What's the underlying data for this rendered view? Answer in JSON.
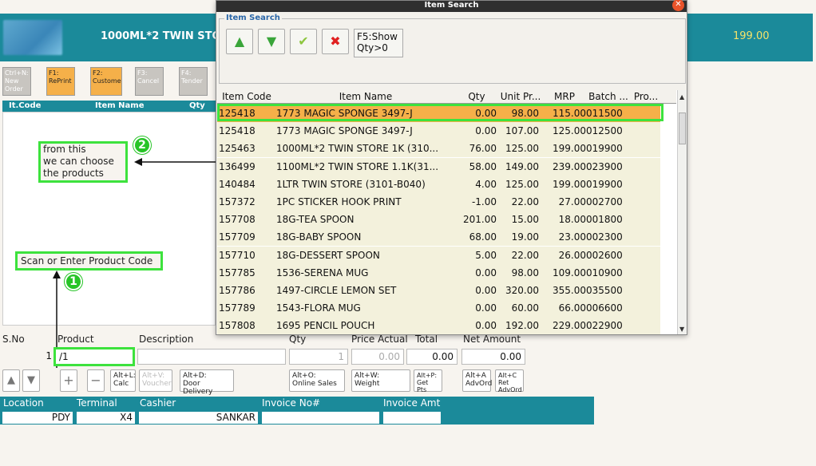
{
  "banner": {
    "title": "1000ML*2 TWIN STOR",
    "amount": "199.00"
  },
  "fkeys": [
    {
      "label": "Ctrl+N:\nNew\nOrder",
      "style": "gray"
    },
    {
      "label": "F1:\nRePrint",
      "style": "orange"
    },
    {
      "label": "F2:\nCustome",
      "style": "orange"
    },
    {
      "label": "F3:\nCancel",
      "style": "gray"
    },
    {
      "label": "F4:\nTender",
      "style": "gray"
    }
  ],
  "left_grid": {
    "col_code": "It.Code",
    "col_name": "Item Name",
    "col_qty": "Qty"
  },
  "annotations": {
    "note2": "from this\nwe can choose\nthe products",
    "badge2": "2",
    "note1": "Scan or Enter Product Code",
    "badge1": "1"
  },
  "form": {
    "sno_label": "S.No",
    "product_label": "Product",
    "description_label": "Description",
    "qty_label": "Qty",
    "price_label": "Price Actual",
    "total_label": "Total",
    "net_label": "Net Amount",
    "sno_value": "1",
    "product_value": "/1",
    "qty_value": "1",
    "price_value": "0.00",
    "total_value": "0.00",
    "net_value": "0.00"
  },
  "action_buttons": {
    "up_icon": "up-arrow-icon",
    "down_icon": "down-arrow-icon",
    "plus": "+",
    "minus": "−",
    "calc": "Alt+L:\nCalc",
    "voucher": "Alt+V:\nVoucher",
    "door": "Alt+D:\nDoor Delivery",
    "online": "Alt+O:\nOnline Sales",
    "weight": "Alt+W:\nWeight",
    "getpts": "Alt+P:\nGet\nPts",
    "advord": "Alt+A\nAdvOrd",
    "retadv": "Alt+C\nRet\nAdvOrd"
  },
  "status": {
    "location_label": "Location",
    "terminal_label": "Terminal",
    "cashier_label": "Cashier",
    "invoice_label": "Invoice No#",
    "invamt_label": "Invoice Amt",
    "location": "PDY",
    "terminal": "X4",
    "cashier": "SANKAR",
    "invoice": "",
    "invamt": ""
  },
  "dialog": {
    "title": "Item Search",
    "group": "Item Search",
    "f5": "F5:Show\nQty>0",
    "tb_up": "▲",
    "tb_down": "▼",
    "tb_ok": "✔",
    "tb_cancel": "✖",
    "columns": {
      "code": "Item Code",
      "name": "Item Name",
      "qty": "Qty",
      "up": "Unit Pr...",
      "mrp": "MRP",
      "batch": "Batch ...",
      "pro": "Pro..."
    },
    "rows": [
      {
        "code": "125418",
        "name": "1773 MAGIC SPONGE 3497-J",
        "qty": "0.00",
        "up": "98.00",
        "mrp": "115.00",
        "batch": "011500"
      },
      {
        "code": "125418",
        "name": "1773 MAGIC SPONGE 3497-J",
        "qty": "0.00",
        "up": "107.00",
        "mrp": "125.00",
        "batch": "012500"
      },
      {
        "code": "125463",
        "name": "1000ML*2 TWIN STORE 1K (310...",
        "qty": "76.00",
        "up": "125.00",
        "mrp": "199.00",
        "batch": "019900"
      },
      {
        "code": "136499",
        "name": "1100ML*2 TWIN STORE 1.1K(31...",
        "qty": "58.00",
        "up": "149.00",
        "mrp": "239.00",
        "batch": "023900"
      },
      {
        "code": "140484",
        "name": "1LTR TWIN STORE (3101-B040)",
        "qty": "4.00",
        "up": "125.00",
        "mrp": "199.00",
        "batch": "019900"
      },
      {
        "code": "157372",
        "name": "1PC STICKER HOOK PRINT",
        "qty": "-1.00",
        "up": "22.00",
        "mrp": "27.00",
        "batch": "002700"
      },
      {
        "code": "157708",
        "name": "18G-TEA SPOON",
        "qty": "201.00",
        "up": "15.00",
        "mrp": "18.00",
        "batch": "001800"
      },
      {
        "code": "157709",
        "name": "18G-BABY SPOON",
        "qty": "68.00",
        "up": "19.00",
        "mrp": "23.00",
        "batch": "002300"
      },
      {
        "code": "157710",
        "name": "18G-DESSERT SPOON",
        "qty": "5.00",
        "up": "22.00",
        "mrp": "26.00",
        "batch": "002600"
      },
      {
        "code": "157785",
        "name": "1536-SERENA MUG",
        "qty": "0.00",
        "up": "98.00",
        "mrp": "109.00",
        "batch": "010900"
      },
      {
        "code": "157786",
        "name": "1497-CIRCLE LEMON SET",
        "qty": "0.00",
        "up": "320.00",
        "mrp": "355.00",
        "batch": "035500"
      },
      {
        "code": "157789",
        "name": "1543-FLORA MUG",
        "qty": "0.00",
        "up": "60.00",
        "mrp": "66.00",
        "batch": "006600"
      },
      {
        "code": "157808",
        "name": "1695 PENCIL POUCH",
        "qty": "0.00",
        "up": "192.00",
        "mrp": "229.00",
        "batch": "022900"
      }
    ]
  },
  "colors": {
    "teal": "#1b8a9a",
    "orange": "#f5b049",
    "annotation": "#3de23d",
    "amount": "#f4e36a"
  }
}
